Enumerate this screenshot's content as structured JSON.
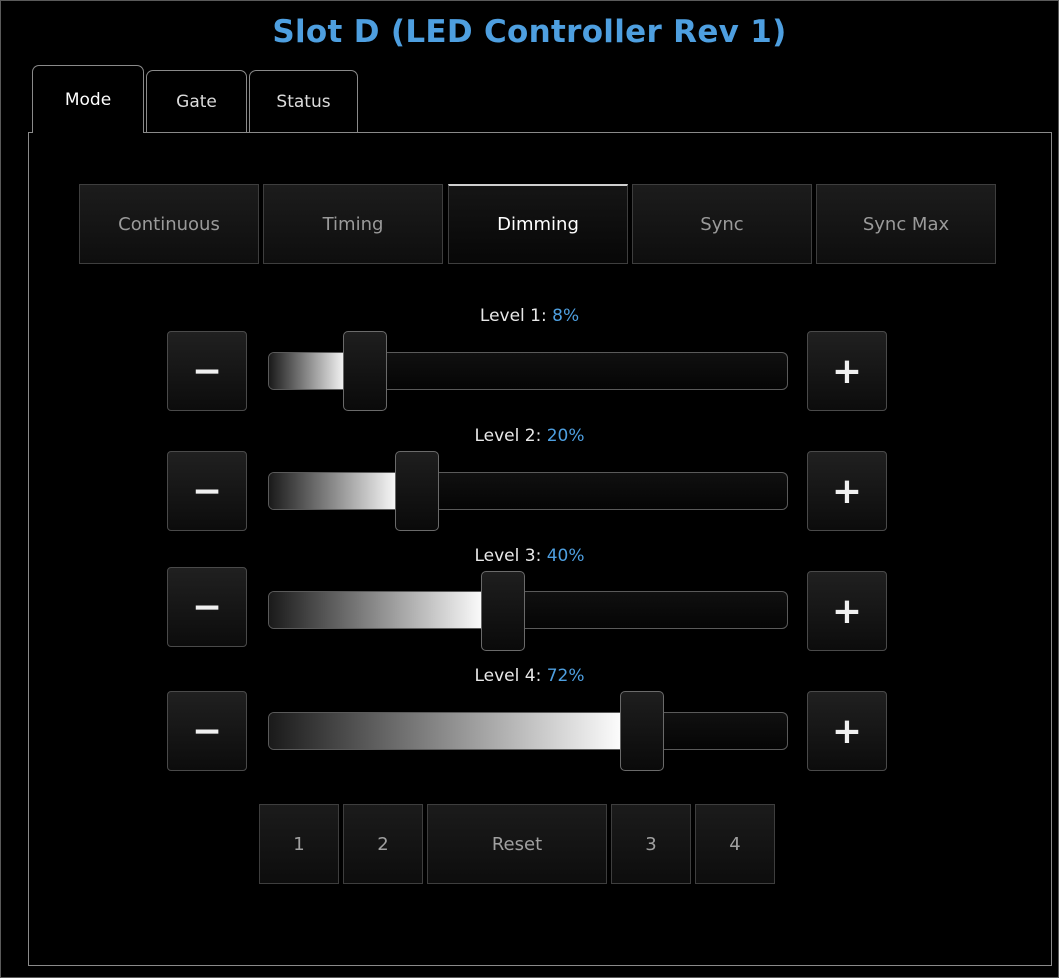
{
  "title": "Slot D (LED Controller Rev 1)",
  "tabs": [
    {
      "label": "Mode",
      "active": true
    },
    {
      "label": "Gate",
      "active": false
    },
    {
      "label": "Status",
      "active": false
    }
  ],
  "modes": [
    {
      "label": "Continuous",
      "selected": false
    },
    {
      "label": "Timing",
      "selected": false
    },
    {
      "label": "Dimming",
      "selected": true
    },
    {
      "label": "Sync",
      "selected": false
    },
    {
      "label": "Sync Max",
      "selected": false
    }
  ],
  "levels": [
    {
      "label": "Level 1:",
      "value_text": "8%",
      "value": 8
    },
    {
      "label": "Level 2:",
      "value_text": "20%",
      "value": 20
    },
    {
      "label": "Level 3:",
      "value_text": "40%",
      "value": 40
    },
    {
      "label": "Level 4:",
      "value_text": "72%",
      "value": 72
    }
  ],
  "stepper": {
    "minus_label": "−",
    "plus_label": "+"
  },
  "presets": [
    {
      "label": "1"
    },
    {
      "label": "2"
    },
    {
      "label": "Reset"
    },
    {
      "label": "3"
    },
    {
      "label": "4"
    }
  ],
  "colors": {
    "accent": "#4e9fe0",
    "background": "#000000"
  }
}
